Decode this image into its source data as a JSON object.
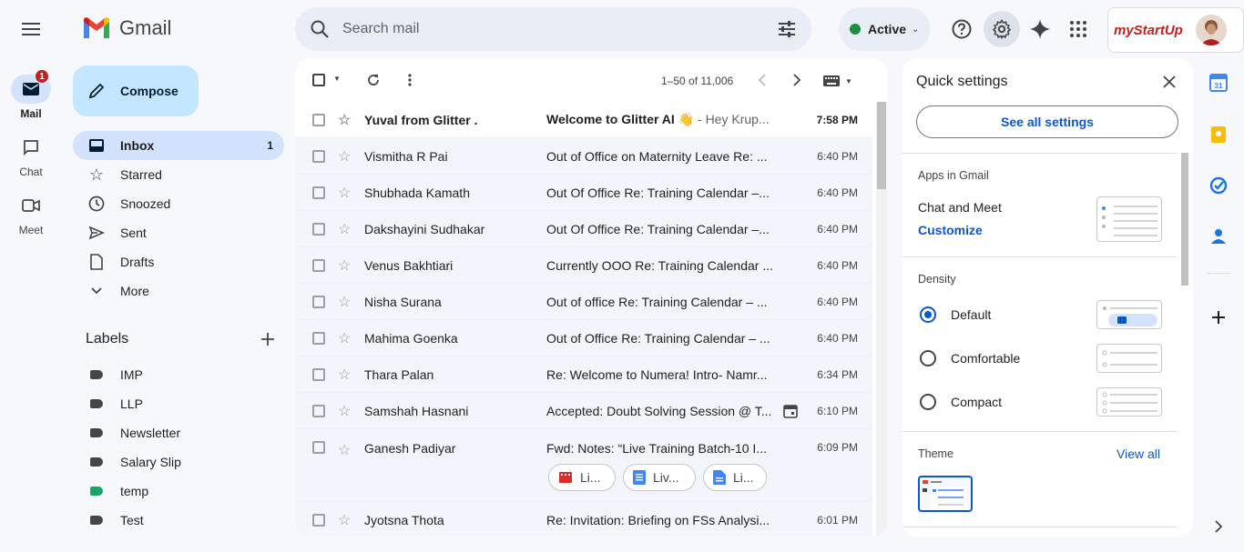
{
  "app": {
    "name": "Gmail"
  },
  "search": {
    "placeholder": "Search mail"
  },
  "status": {
    "label": "Active"
  },
  "brand": {
    "name": "myStartUp"
  },
  "rail": [
    {
      "label": "Mail",
      "badge": "1"
    },
    {
      "label": "Chat"
    },
    {
      "label": "Meet"
    }
  ],
  "compose": {
    "label": "Compose"
  },
  "nav": [
    {
      "label": "Inbox",
      "count": "1",
      "icon": "inbox-icon"
    },
    {
      "label": "Starred",
      "icon": "star-icon"
    },
    {
      "label": "Snoozed",
      "icon": "clock-icon"
    },
    {
      "label": "Sent",
      "icon": "send-icon"
    },
    {
      "label": "Drafts",
      "icon": "draft-icon"
    },
    {
      "label": "More",
      "icon": "chevron-down-icon"
    }
  ],
  "labels": {
    "title": "Labels",
    "items": [
      {
        "name": "IMP",
        "color": "#444746"
      },
      {
        "name": "LLP",
        "color": "#444746"
      },
      {
        "name": "Newsletter",
        "color": "#444746"
      },
      {
        "name": "Salary Slip",
        "color": "#444746"
      },
      {
        "name": "temp",
        "color": "#16a765"
      },
      {
        "name": "Test",
        "color": "#444746"
      }
    ]
  },
  "toolbar": {
    "pagination": "1–50 of 11,006"
  },
  "emails": [
    {
      "sender": "Yuval from Glitter .",
      "subject": "Welcome to Glitter AI 👋",
      "snippet": " - Hey Krup...",
      "time": "7:58 PM",
      "unread": true
    },
    {
      "sender": "Vismitha R Pai",
      "subject": "Out of Office on Maternity Leave Re: ...",
      "snippet": "",
      "time": "6:40 PM"
    },
    {
      "sender": "Shubhada Kamath",
      "subject": "Out Of Office Re: Training Calendar –...",
      "snippet": "",
      "time": "6:40 PM"
    },
    {
      "sender": "Dakshayini Sudhakar",
      "subject": "Out Of Office Re: Training Calendar –...",
      "snippet": "",
      "time": "6:40 PM"
    },
    {
      "sender": "Venus Bakhtiari",
      "subject": "Currently OOO Re: Training Calendar ...",
      "snippet": "",
      "time": "6:40 PM"
    },
    {
      "sender": "Nisha Surana",
      "subject": "Out of office Re: Training Calendar – ...",
      "snippet": "",
      "time": "6:40 PM"
    },
    {
      "sender": "Mahima Goenka",
      "subject": "Out of Office Re: Training Calendar – ...",
      "snippet": "",
      "time": "6:40 PM"
    },
    {
      "sender": "Thara Palan",
      "subject": "Re: Welcome to Numera! Intro- Namr...",
      "snippet": "",
      "time": "6:34 PM"
    },
    {
      "sender": "Samshah Hasnani",
      "subject": "Accepted: Doubt Solving Session @ T...",
      "snippet": "",
      "time": "6:10 PM"
    },
    {
      "sender": "Ganesh Padiyar",
      "subject": "Fwd: Notes: “Live Training Batch-10 I...",
      "snippet": "",
      "time": "6:09 PM"
    },
    {
      "sender": "Jyotsna Thota",
      "subject": "Re: Invitation: Briefing on FSs Analysi...",
      "snippet": "",
      "time": "6:01 PM"
    }
  ],
  "attachments": [
    {
      "label": "Li...",
      "icon": "video-file-icon",
      "color": "#d93025"
    },
    {
      "label": "Liv...",
      "icon": "slides-file-icon",
      "color": "#4285f4"
    },
    {
      "label": "Li...",
      "icon": "doc-file-icon",
      "color": "#4285f4"
    }
  ],
  "quick_settings": {
    "title": "Quick settings",
    "see_all": "See all settings",
    "apps_title": "Apps in Gmail",
    "apps_item": "Chat and Meet",
    "customize": "Customize",
    "density_title": "Density",
    "density": [
      {
        "label": "Default",
        "selected": true
      },
      {
        "label": "Comfortable",
        "selected": false
      },
      {
        "label": "Compact",
        "selected": false
      }
    ],
    "theme_title": "Theme",
    "view_all": "View all"
  },
  "colors": {
    "accent": "#0b57d0",
    "selected": "#d3e3fd",
    "compose": "#c2e7ff"
  }
}
